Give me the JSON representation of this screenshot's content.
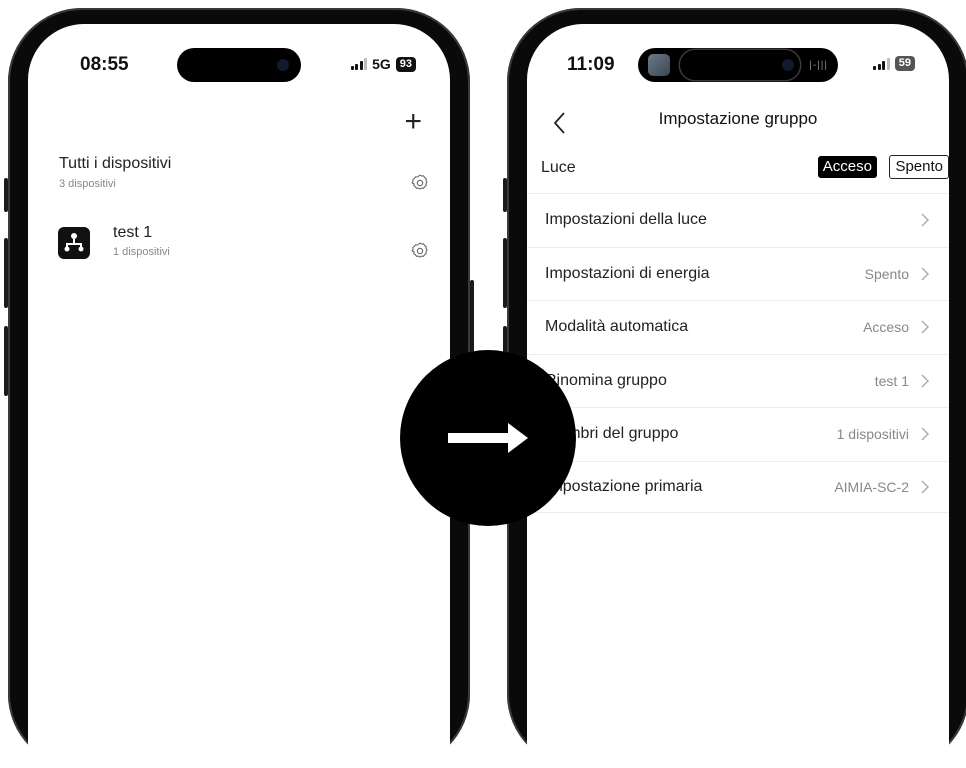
{
  "left_phone": {
    "status": {
      "time": "08:55",
      "network": "5G",
      "battery": "93"
    },
    "add_icon": "plus-icon",
    "group": {
      "title": "Tutti i dispositivi",
      "subtitle": "3 dispositivi"
    },
    "device": {
      "name": "test 1",
      "subtitle": "1 dispositivi"
    }
  },
  "right_phone": {
    "status": {
      "time": "11:09",
      "battery": "59"
    },
    "nav": {
      "title": "Impostazione gruppo"
    },
    "luce": {
      "label": "Luce",
      "on_label": "Acceso",
      "off_label": "Spento"
    },
    "rows": [
      {
        "label": "Impostazioni della luce",
        "value": ""
      },
      {
        "label": "Impostazioni di energia",
        "value": "Spento"
      },
      {
        "label": "Modalità automatica",
        "value": "Acceso"
      },
      {
        "label": "Rinomina gruppo",
        "value": "test 1"
      },
      {
        "label": "Membri del gruppo",
        "value": "1 dispositivi"
      },
      {
        "label": "Impostazione primaria",
        "value": "AIMIA-SC-2"
      }
    ]
  },
  "overlay": {
    "icon": "arrow-right-icon"
  }
}
